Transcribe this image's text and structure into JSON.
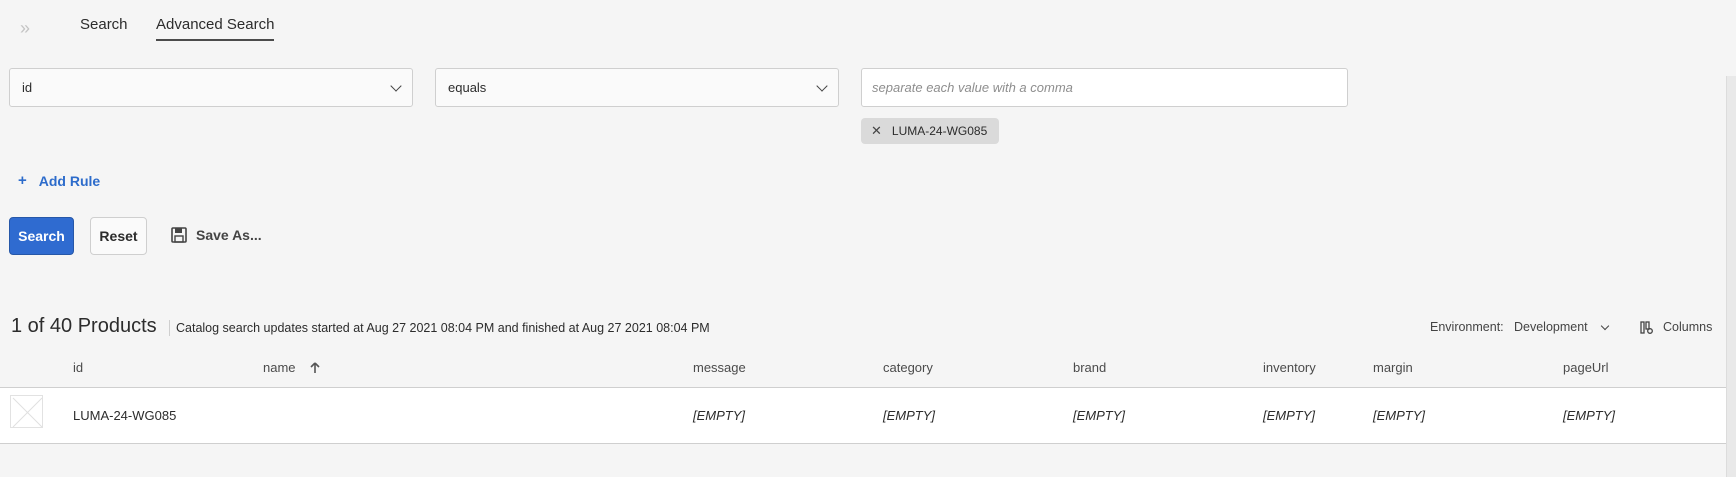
{
  "nav": {
    "collapse_glyph": "»",
    "tabs": [
      {
        "label": "Search"
      },
      {
        "label": "Advanced Search"
      }
    ]
  },
  "rule": {
    "field_value": "id",
    "operator_value": "equals",
    "values_placeholder": "separate each value with a comma",
    "values_input": "",
    "tags": [
      "LUMA-24-WG085"
    ]
  },
  "add_rule_label": "Add Rule",
  "actions": {
    "search_label": "Search",
    "reset_label": "Reset",
    "save_as_label": "Save As..."
  },
  "results": {
    "count_label": "1 of 40 Products",
    "status_text": "Catalog search updates started at Aug 27 2021 08:04 PM and finished at Aug 27 2021 08:04 PM",
    "environment_label": "Environment:",
    "environment_value": "Development",
    "columns_label": "Columns"
  },
  "table": {
    "columns": [
      "id",
      "name",
      "message",
      "category",
      "brand",
      "inventory",
      "margin",
      "pageUrl"
    ],
    "sort": {
      "column": "name",
      "direction": "ascending"
    },
    "rows": [
      {
        "id": "LUMA-24-WG085",
        "name": "",
        "message": "[EMPTY]",
        "category": "[EMPTY]",
        "brand": "[EMPTY]",
        "inventory": "[EMPTY]",
        "margin": "[EMPTY]",
        "pageUrl": "[EMPTY]"
      }
    ]
  },
  "colors": {
    "accent": "#2f6bd0",
    "link": "#2d6ccb",
    "background": "#f5f5f5",
    "tag_bg": "#dadada"
  }
}
